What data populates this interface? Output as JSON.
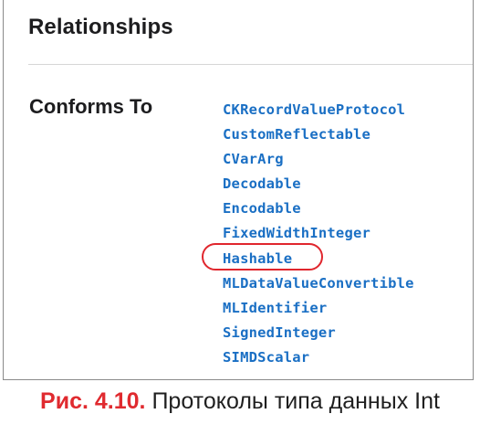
{
  "section": {
    "heading": "Relationships",
    "conforms_label": "Conforms To"
  },
  "protocols": [
    {
      "name": "CKRecordValueProtocol",
      "highlighted": false
    },
    {
      "name": "CustomReflectable",
      "highlighted": false
    },
    {
      "name": "CVarArg",
      "highlighted": false
    },
    {
      "name": "Decodable",
      "highlighted": false
    },
    {
      "name": "Encodable",
      "highlighted": false
    },
    {
      "name": "FixedWidthInteger",
      "highlighted": false
    },
    {
      "name": "Hashable",
      "highlighted": true
    },
    {
      "name": "MLDataValueConvertible",
      "highlighted": false
    },
    {
      "name": "MLIdentifier",
      "highlighted": false
    },
    {
      "name": "SignedInteger",
      "highlighted": false
    },
    {
      "name": "SIMDScalar",
      "highlighted": false
    }
  ],
  "caption": {
    "prefix": "Рис. 4.10.",
    "text": " Протоколы типа данных Int"
  },
  "colors": {
    "link": "#1a6fc4",
    "highlight_ring": "#e0262d",
    "caption_prefix": "#e02a2f"
  }
}
